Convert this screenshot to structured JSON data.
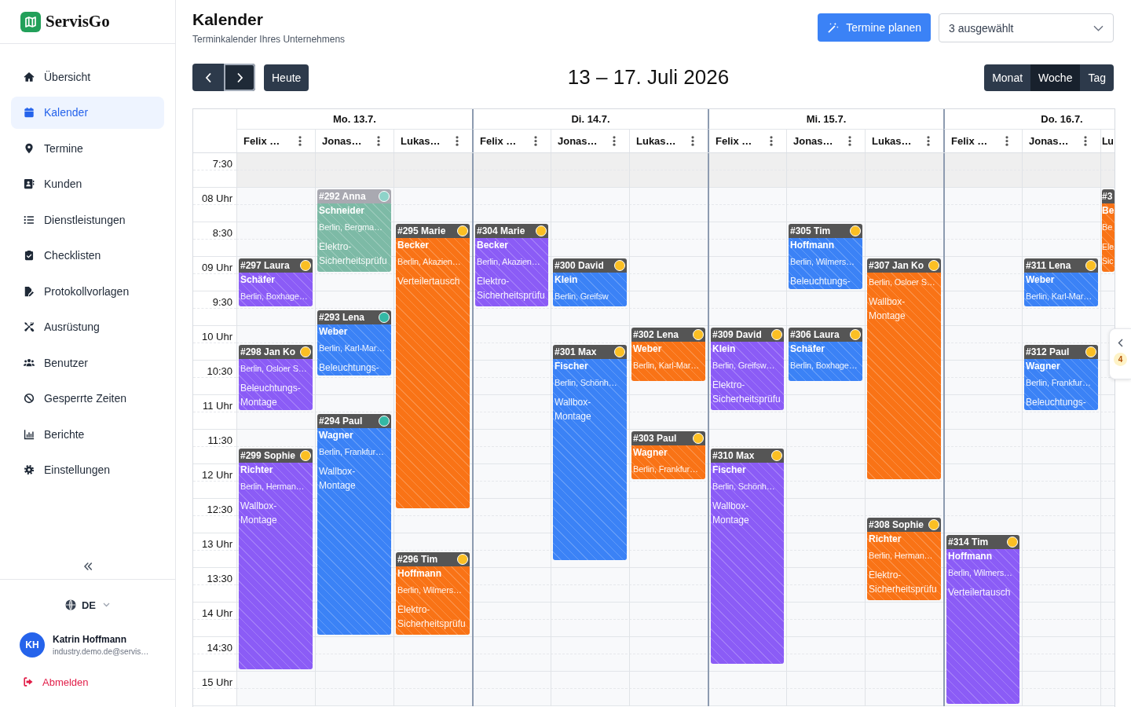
{
  "sidebar": {
    "logo": {
      "text": "ServisGo"
    },
    "nav": [
      {
        "label": "Übersicht",
        "selected": false
      },
      {
        "label": "Kalender",
        "selected": true
      },
      {
        "label": "Termine",
        "selected": false
      },
      {
        "label": "Kunden",
        "selected": false
      },
      {
        "label": "Dienstleistungen",
        "selected": false
      },
      {
        "label": "Checklisten",
        "selected": false
      },
      {
        "label": "Protokollvorlagen",
        "selected": false
      },
      {
        "label": "Ausrüstung",
        "selected": false
      },
      {
        "label": "Benutzer",
        "selected": false
      },
      {
        "label": "Gesperrte Zeiten",
        "selected": false
      },
      {
        "label": "Berichte",
        "selected": false
      },
      {
        "label": "Einstellungen",
        "selected": false
      }
    ],
    "language": {
      "label": "DE"
    },
    "user": {
      "initials": "KH",
      "name": "Katrin Hoffmann",
      "email": "industry.demo.de@servis…"
    },
    "logout": {
      "label": "Abmelden"
    }
  },
  "header": {
    "title": "Kalender",
    "subtitle": "Terminkalender Ihres Unternehmens",
    "plan_button": {
      "label": "Termine planen"
    },
    "resource_select": {
      "value": "3 ausgewählt"
    }
  },
  "toolbar": {
    "nav_buttons": [
      {
        "kind": "prev",
        "focused": false
      },
      {
        "kind": "next",
        "focused": true
      }
    ],
    "today_button": {
      "label": "Heute"
    },
    "range_title": "13 – 17. Juli 2026",
    "views": [
      {
        "label": "Monat",
        "selected": false
      },
      {
        "label": "Woche",
        "selected": true
      },
      {
        "label": "Tag",
        "selected": false
      }
    ]
  },
  "calendar": {
    "time_slots": [
      {
        "label": "7:30",
        "off_hours": true
      },
      {
        "label": "08 Uhr",
        "off_hours": false
      },
      {
        "label": "8:30",
        "off_hours": false
      },
      {
        "label": "09 Uhr",
        "off_hours": false
      },
      {
        "label": "9:30",
        "off_hours": false
      },
      {
        "label": "10 Uhr",
        "off_hours": false
      },
      {
        "label": "10:30",
        "off_hours": false
      },
      {
        "label": "11 Uhr",
        "off_hours": false
      },
      {
        "label": "11:30",
        "off_hours": false
      },
      {
        "label": "12 Uhr",
        "off_hours": false
      },
      {
        "label": "12:30",
        "off_hours": false
      },
      {
        "label": "13 Uhr",
        "off_hours": false
      },
      {
        "label": "13:30",
        "off_hours": false
      },
      {
        "label": "14 Uhr",
        "off_hours": false
      },
      {
        "label": "14:30",
        "off_hours": false
      },
      {
        "label": "15 Uhr",
        "off_hours": false
      }
    ],
    "days": [
      {
        "label": "Mo. 13.7.",
        "resources": [
          {
            "name": "Felix …",
            "events": [
              {
                "title": "#297 Laura Schäfer",
                "address": "Berlin, Boxhage…",
                "color": "#8b5cf6",
                "status_dot": {
                  "color": "#fbbf24"
                },
                "dimmed": false
              },
              {
                "title": "#298 Jan Ko",
                "address": "Berlin, Osloer S…",
                "service": "Beleuchtungs-Montage",
                "color": "#8b5cf6",
                "status_dot": {
                  "color": "#fbbf24"
                },
                "dimmed": false
              },
              {
                "title": "#299 Sophie Richter",
                "address": "Berlin, Herman…",
                "service": "Wallbox-Montage",
                "color": "#8b5cf6",
                "status_dot": {
                  "color": "#fbbf24"
                },
                "dimmed": false
              }
            ]
          },
          {
            "name": "Jonas…",
            "events": [
              {
                "title": "#292 Anna Schneider",
                "address": "Berlin, Bergma…",
                "service": "Elektro-Sicherheitsprüfu",
                "color": "#7dbaa6",
                "status_dot": {
                  "color": "#8ed3c9"
                },
                "dimmed": true
              },
              {
                "title": "#293 Lena Weber",
                "address": "Berlin, Karl-Mar…",
                "service": "Beleuchtungs-",
                "color": "#3b82f6",
                "status_dot": {
                  "color": "#34b8a5"
                },
                "dimmed": false
              },
              {
                "title": "#294 Paul Wagner",
                "address": "Berlin, Frankfur…",
                "service": "Wallbox-Montage",
                "color": "#3b82f6",
                "status_dot": {
                  "color": "#34b8a5"
                },
                "dimmed": false
              }
            ]
          },
          {
            "name": "Lukas…",
            "events": [
              {
                "title": "#295 Marie Becker",
                "address": "Berlin, Akazien…",
                "service": "Verteilertausch",
                "color": "#f97316",
                "status_dot": {
                  "color": "#fbbf24"
                },
                "dimmed": false
              },
              {
                "title": "#296 Tim Hoffmann",
                "address": "Berlin, Wilmers…",
                "service": "Elektro-Sicherheitsprüfu",
                "color": "#f97316",
                "status_dot": {
                  "color": "#fbbf24"
                },
                "dimmed": false
              }
            ]
          }
        ]
      },
      {
        "label": "Di. 14.7.",
        "resources": [
          {
            "name": "Felix …",
            "events": [
              {
                "title": "#304 Marie Becker",
                "address": "Berlin, Akazien…",
                "service": "Elektro-Sicherheitsprüfu",
                "color": "#8b5cf6",
                "status_dot": {
                  "color": "#fbbf24"
                },
                "dimmed": false
              }
            ]
          },
          {
            "name": "Jonas…",
            "events": [
              {
                "title": "#300 David Klein",
                "address": "Berlin, Greifsw",
                "color": "#3b82f6",
                "status_dot": {
                  "color": "#fbbf24"
                },
                "dimmed": false
              },
              {
                "title": "#301 Max Fischer",
                "address": "Berlin, Schönh…",
                "service": "Wallbox-Montage",
                "color": "#3b82f6",
                "status_dot": {
                  "color": "#fbbf24"
                },
                "dimmed": false
              }
            ]
          },
          {
            "name": "Lukas…",
            "events": [
              {
                "title": "#302 Lena Weber",
                "address": "Berlin, Karl-Mar…",
                "color": "#f97316",
                "status_dot": {
                  "color": "#fbbf24"
                },
                "dimmed": false
              },
              {
                "title": "#303 Paul Wagner",
                "address": "Berlin, Frankfur…",
                "color": "#f97316",
                "status_dot": {
                  "color": "#fbbf24"
                },
                "dimmed": false
              }
            ]
          }
        ]
      },
      {
        "label": "Mi. 15.7.",
        "resources": [
          {
            "name": "Felix …",
            "events": [
              {
                "title": "#309 David Klein",
                "address": "Berlin, Greifsw…",
                "service": "Elektro-Sicherheitsprüfu",
                "color": "#8b5cf6",
                "status_dot": {
                  "color": "#fbbf24"
                },
                "dimmed": false
              },
              {
                "title": "#310 Max Fischer",
                "address": "Berlin, Schönh…",
                "service": "Wallbox-Montage",
                "color": "#8b5cf6",
                "status_dot": {
                  "color": "#fbbf24"
                },
                "dimmed": false
              }
            ]
          },
          {
            "name": "Jonas…",
            "events": [
              {
                "title": "#305 Tim Hoffmann",
                "address": "Berlin, Wilmers…",
                "service": "Beleuchtungs-",
                "color": "#3b82f6",
                "status_dot": {
                  "color": "#fbbf24"
                },
                "dimmed": false
              },
              {
                "title": "#306 Laura Schäfer",
                "address": "Berlin, Boxhage…",
                "color": "#3b82f6",
                "status_dot": {
                  "color": "#fbbf24"
                },
                "dimmed": false
              }
            ]
          },
          {
            "name": "Lukas…",
            "events": [
              {
                "title": "#307 Jan Ko",
                "address": "Berlin, Osloer S…",
                "service": "Wallbox-Montage",
                "color": "#f97316",
                "status_dot": {
                  "color": "#fbbf24"
                },
                "dimmed": false
              },
              {
                "title": "#308 Sophie Richter",
                "address": "Berlin, Herman…",
                "service": "Elektro-Sicherheitsprüfu",
                "color": "#f97316",
                "status_dot": {
                  "color": "#fbbf24"
                },
                "dimmed": false
              }
            ]
          }
        ]
      },
      {
        "label": "Do. 16.7.",
        "resources": [
          {
            "name": "Felix …",
            "events": [
              {
                "title": "#314 Tim Hoffmann",
                "address": "Berlin, Wilmers…",
                "service": "Verteilertausch",
                "color": "#8b5cf6",
                "status_dot": {
                  "color": "#fbbf24"
                },
                "dimmed": false
              }
            ]
          },
          {
            "name": "Jonas…",
            "events": [
              {
                "title": "#311 Lena Weber",
                "address": "Berlin, Karl-Mar…",
                "color": "#3b82f6",
                "status_dot": {
                  "color": "#fbbf24"
                },
                "dimmed": false
              },
              {
                "title": "#312 Paul Wagner",
                "address": "Berlin, Frankfur…",
                "service": "Beleuchtungs-",
                "color": "#3b82f6",
                "status_dot": {
                  "color": "#fbbf24"
                },
                "dimmed": false
              }
            ]
          },
          {
            "name": "Lu",
            "events": [
              {
                "title": "#3 Be",
                "address": "Be",
                "service": "Ele Sic",
                "color": "#f97316",
                "dimmed": false
              }
            ]
          }
        ]
      }
    ]
  },
  "side_panel_tab": {
    "badge": "4"
  }
}
